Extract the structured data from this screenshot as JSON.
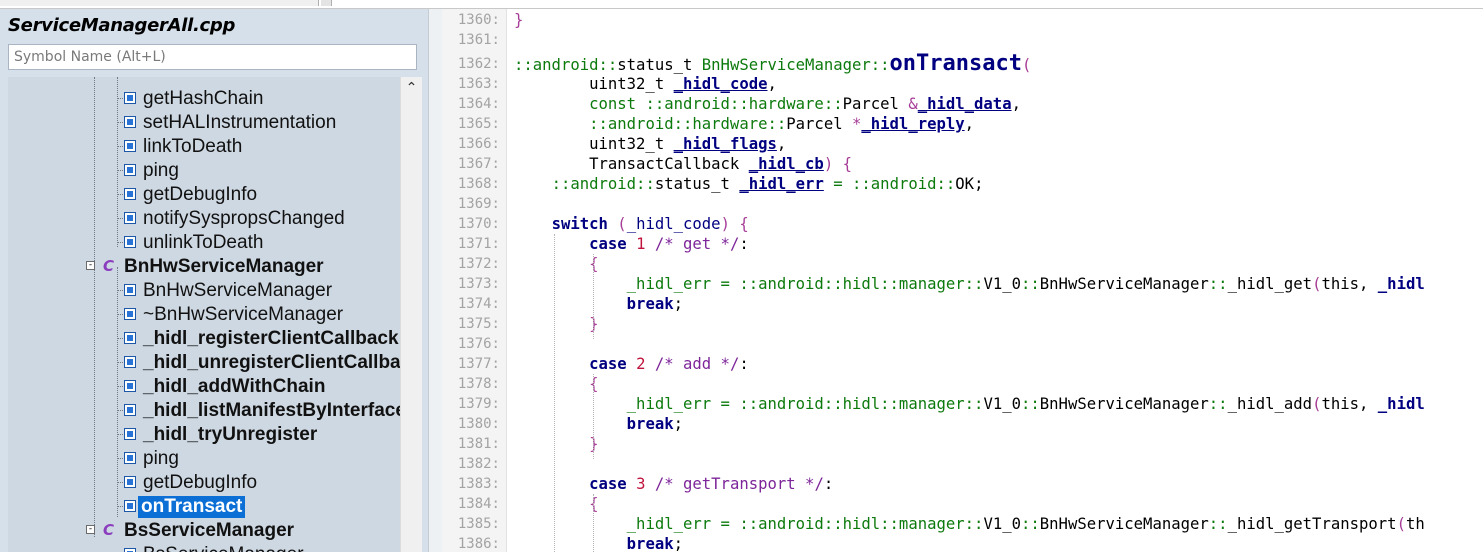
{
  "sidebar": {
    "file_title": "ServiceManagerAll.cpp",
    "search_placeholder": "Symbol Name (Alt+L)",
    "tree": [
      {
        "label": "getHashChain",
        "icon": "method-icon",
        "bold": false,
        "selected": false
      },
      {
        "label": "setHALInstrumentation",
        "icon": "method-icon",
        "bold": false,
        "selected": false
      },
      {
        "label": "linkToDeath",
        "icon": "method-icon",
        "bold": false,
        "selected": false
      },
      {
        "label": "ping",
        "icon": "method-icon",
        "bold": false,
        "selected": false
      },
      {
        "label": "getDebugInfo",
        "icon": "method-icon",
        "bold": false,
        "selected": false
      },
      {
        "label": "notifySyspropsChanged",
        "icon": "method-icon",
        "bold": false,
        "selected": false
      },
      {
        "label": "unlinkToDeath",
        "icon": "method-icon",
        "bold": false,
        "selected": false
      },
      {
        "label": "BnHwServiceManager",
        "icon": "class-icon",
        "bold": true,
        "selected": false,
        "toggle": "-"
      },
      {
        "label": "BnHwServiceManager",
        "icon": "method-icon",
        "bold": false,
        "selected": false
      },
      {
        "label": "~BnHwServiceManager",
        "icon": "method-icon",
        "bold": false,
        "selected": false
      },
      {
        "label": "_hidl_registerClientCallback",
        "icon": "method-icon",
        "bold": true,
        "selected": false
      },
      {
        "label": "_hidl_unregisterClientCallbac",
        "icon": "method-icon",
        "bold": true,
        "selected": false
      },
      {
        "label": "_hidl_addWithChain",
        "icon": "method-icon",
        "bold": true,
        "selected": false
      },
      {
        "label": "_hidl_listManifestByInterface",
        "icon": "method-icon",
        "bold": true,
        "selected": false
      },
      {
        "label": "_hidl_tryUnregister",
        "icon": "method-icon",
        "bold": true,
        "selected": false
      },
      {
        "label": "ping",
        "icon": "method-icon",
        "bold": false,
        "selected": false
      },
      {
        "label": "getDebugInfo",
        "icon": "method-icon",
        "bold": false,
        "selected": false
      },
      {
        "label": "onTransact",
        "icon": "method-icon",
        "bold": true,
        "selected": true
      },
      {
        "label": "BsServiceManager",
        "icon": "class-icon",
        "bold": true,
        "selected": false,
        "toggle": "-"
      },
      {
        "label": "BsServiceManager",
        "icon": "method-icon",
        "bold": false,
        "selected": false
      }
    ]
  },
  "editor": {
    "lines": [
      {
        "n": "1360:",
        "html": "<span class=\"par\">}</span>"
      },
      {
        "n": "1361:",
        "html": ""
      },
      {
        "n": "1362:",
        "html": "<span class=\"ns\">::android::</span>status_t <span class=\"ns\">BnHwServiceManager::</span><span class=\"fn\">onTransact</span><span class=\"par\">(</span>"
      },
      {
        "n": "1363:",
        "html": "        uint32_t <span class=\"ul\">_hidl_code</span>,"
      },
      {
        "n": "1364:",
        "html": "        <span class=\"ns\">const ::android::hardware::</span>Parcel <span class=\"par\">&amp;</span><span class=\"ul\">_hidl_data</span>,"
      },
      {
        "n": "1365:",
        "html": "        <span class=\"ns\">::android::hardware::</span>Parcel <span class=\"par\">*</span><span class=\"ul\">_hidl_reply</span>,"
      },
      {
        "n": "1366:",
        "html": "        uint32_t <span class=\"ul\">_hidl_flags</span>,"
      },
      {
        "n": "1367:",
        "html": "        TransactCallback <span class=\"ul\">_hidl_cb</span><span class=\"par\">) {</span>"
      },
      {
        "n": "1368:",
        "html": "    <span class=\"ns\">::android::</span>status_t <span class=\"ul\">_hidl_err</span> <span class=\"ns\">=</span> <span class=\"ns\">::android::</span>OK;"
      },
      {
        "n": "1369:",
        "html": ""
      },
      {
        "n": "1370:",
        "html": "    <span class=\"k\">switch</span> <span class=\"par\">(</span><span class=\"k\" style=\"font-weight:normal\">_hidl_code</span><span class=\"par\">) {</span>"
      },
      {
        "n": "1371:",
        "html": "        <span class=\"k\">case</span> <span class=\"num\">1</span> <span class=\"cm\">/* get */</span>:"
      },
      {
        "n": "1372:",
        "html": "        <span class=\"par\">{</span>"
      },
      {
        "n": "1373:",
        "html": "            <span class=\"ns\">_hidl_err = ::android::hidl::manager::</span>V1_0<span class=\"ns\">::</span>BnHwServiceManager<span class=\"ns\">::</span>_hidl_get<span class=\"par\">(</span>this, <span class=\"k\">_hidl</span>"
      },
      {
        "n": "1374:",
        "html": "            <span class=\"k\">break</span>;"
      },
      {
        "n": "1375:",
        "html": "        <span class=\"par\">}</span>"
      },
      {
        "n": "1376:",
        "html": ""
      },
      {
        "n": "1377:",
        "html": "        <span class=\"k\">case</span> <span class=\"num\">2</span> <span class=\"cm\">/* add */</span>:"
      },
      {
        "n": "1378:",
        "html": "        <span class=\"par\">{</span>"
      },
      {
        "n": "1379:",
        "html": "            <span class=\"ns\">_hidl_err = ::android::hidl::manager::</span>V1_0<span class=\"ns\">::</span>BnHwServiceManager<span class=\"ns\">::</span>_hidl_add<span class=\"par\">(</span>this, <span class=\"k\">_hidl</span>"
      },
      {
        "n": "1380:",
        "html": "            <span class=\"k\">break</span>;"
      },
      {
        "n": "1381:",
        "html": "        <span class=\"par\">}</span>"
      },
      {
        "n": "1382:",
        "html": ""
      },
      {
        "n": "1383:",
        "html": "        <span class=\"k\">case</span> <span class=\"num\">3</span> <span class=\"cm\">/* getTransport */</span>:"
      },
      {
        "n": "1384:",
        "html": "        <span class=\"par\">{</span>"
      },
      {
        "n": "1385:",
        "html": "            <span class=\"ns\">_hidl_err = ::android::hidl::manager::</span>V1_0<span class=\"ns\">::</span>BnHwServiceManager<span class=\"ns\">::</span>_hidl_getTransport<span class=\"par\">(</span>th"
      },
      {
        "n": "1386:",
        "html": "            <span class=\"k\">break</span>;"
      }
    ]
  },
  "colors": {
    "selection": "#0b6fd6",
    "highlight_box": "#e21f1f",
    "keyword": "#000080",
    "namespace": "#0d7a0d",
    "number": "#c0143c",
    "comment": "#7d2599"
  }
}
